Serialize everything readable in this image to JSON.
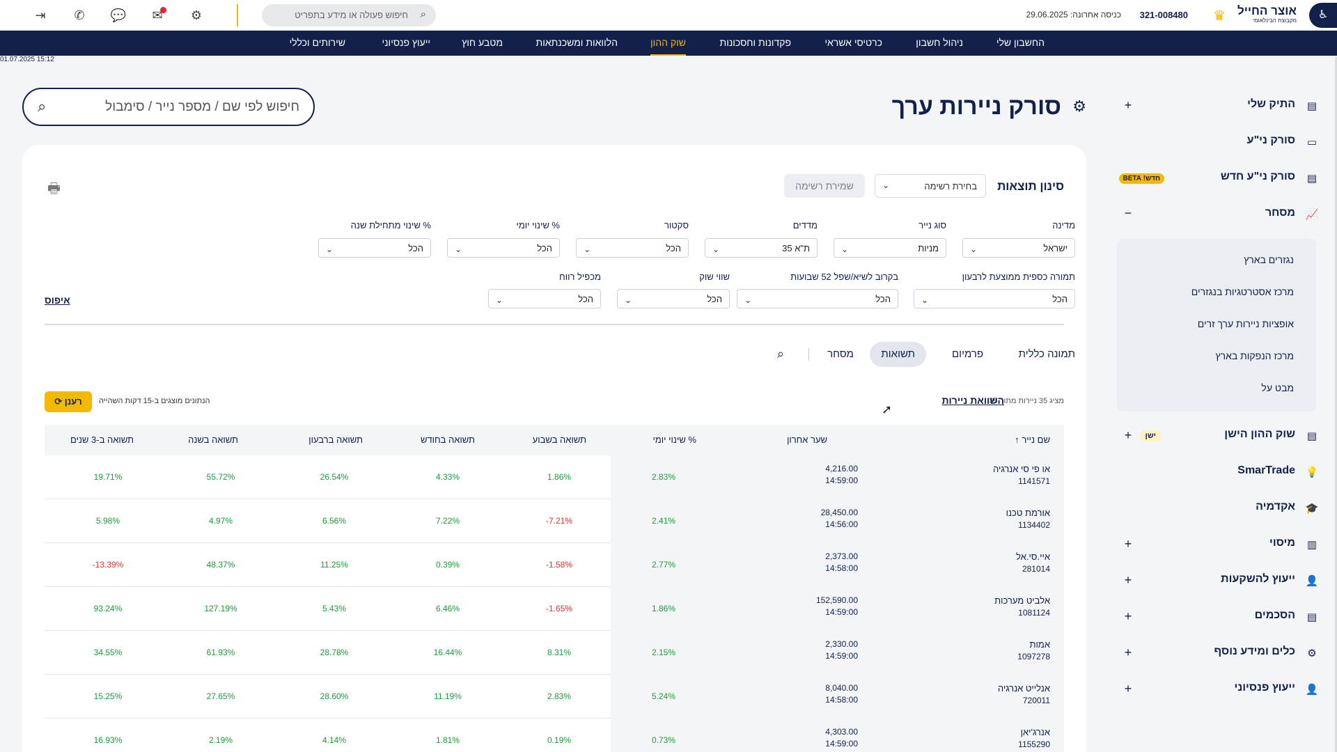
{
  "header": {
    "logo_main": "אוצר החייל",
    "logo_sub": "מקבוצת הבינלאומי",
    "account": "321-008480",
    "last_login": "כניסה אחרונה: 29.06.2025",
    "search_placeholder": "חיפוש פעולה או מידע בתפריט"
  },
  "nav": [
    "החשבון שלי",
    "ניהול חשבון",
    "כרטיסי אשראי",
    "פקדונות וחסכונות",
    "שוק ההון",
    "הלוואות ומשכנתאות",
    "מטבע חוץ",
    "ייעוץ פנסיוני",
    "שירותים וכללי"
  ],
  "nav_active": "שוק ההון",
  "datetime": "01.07.2025 15:12",
  "sidebar": {
    "items": [
      "התיק שלי",
      "סורק ני\"ע",
      "סורק ני\"ע חדש",
      "מסחר",
      "שוק ההון הישן",
      "SmarTrade",
      "אקדמיה",
      "מיסוי",
      "ייעוץ להשקעות",
      "הסכמים",
      "כלים ומידע נוסף",
      "ייעוץ פנסיוני"
    ],
    "badge_new": "חדש! BETA",
    "badge_old": "ישן",
    "submenu": [
      "נגזרים בארץ",
      "מרכז אסטרטגיות בנגזרים",
      "אופציות ניירות ערך זרים",
      "מרכז הנפקות בארץ",
      "מבט על"
    ]
  },
  "page": {
    "title": "סורק ניירות ערך",
    "search_placeholder": "חיפוש לפי שם / מספר נייר / סימבול"
  },
  "filters": {
    "title": "סינון תוצאות",
    "list_select": "בחירת רשימה",
    "save_list": "שמירת רשימה",
    "row1": [
      {
        "label": "מדינה",
        "value": "ישראל"
      },
      {
        "label": "סוג נייר",
        "value": "מניות"
      },
      {
        "label": "מדדים",
        "value": "ת\"א 35"
      },
      {
        "label": "סקטור",
        "value": "הכל"
      },
      {
        "label": "% שינוי יומי",
        "value": "הכל"
      },
      {
        "label": "% שינוי מתחילת שנה",
        "value": "הכל"
      }
    ],
    "row2": [
      {
        "label": "תמורה כספית ממוצעת לרבעון",
        "value": "הכל"
      },
      {
        "label": "בקרוב לשיא/שפל 52 שבועות",
        "value": "הכל"
      },
      {
        "label": "שווי שוק",
        "value": "הכל"
      },
      {
        "label": "מכפיל רווח",
        "value": "הכל"
      }
    ],
    "reset": "איפוס"
  },
  "tabs": [
    "תמונה כללית",
    "פרמיום",
    "תשואות",
    "מסחר"
  ],
  "tab_active": "תשואות",
  "results": {
    "count": "מציג 35 ניירות מתוך 35",
    "compare": "השוואת ניירות",
    "delay": "הנתונים מוצגים ב-15 דקות השהייה",
    "refresh": "רענן"
  },
  "table": {
    "headers": [
      "שם נייר",
      "שער אחרון",
      "% שינוי יומי",
      "תשואה בשבוע",
      "תשואה בחודש",
      "תשואה ברבעון",
      "תשואה בשנה",
      "תשואה ב-3 שנים"
    ],
    "rows": [
      {
        "name": "או פי סי אנרגיה",
        "num": "1141571",
        "price": "4,216.00",
        "time": "14:59:00",
        "vals": [
          "2.83%",
          "1.86%",
          "4.33%",
          "26.54%",
          "55.72%",
          "19.71%"
        ]
      },
      {
        "name": "אורמת טכנו",
        "num": "1134402",
        "price": "28,450.00",
        "time": "14:56:00",
        "vals": [
          "2.41%",
          "-7.21%",
          "7.22%",
          "6.56%",
          "4.97%",
          "5.98%"
        ]
      },
      {
        "name": "איי.סי.אל",
        "num": "281014",
        "price": "2,373.00",
        "time": "14:58:00",
        "vals": [
          "2.77%",
          "-1.58%",
          "0.39%",
          "11.25%",
          "48.37%",
          "-13.39%"
        ]
      },
      {
        "name": "אלביט מערכות",
        "num": "1081124",
        "price": "152,590.00",
        "time": "14:59:00",
        "vals": [
          "1.86%",
          "-1.65%",
          "6.46%",
          "5.43%",
          "127.19%",
          "93.24%"
        ]
      },
      {
        "name": "אמות",
        "num": "1097278",
        "price": "2,330.00",
        "time": "14:59:00",
        "vals": [
          "2.15%",
          "8.31%",
          "16.44%",
          "28.78%",
          "61.93%",
          "34.55%"
        ]
      },
      {
        "name": "אנלייט אנרגיה",
        "num": "720011",
        "price": "8,040.00",
        "time": "14:58:00",
        "vals": [
          "5.24%",
          "2.83%",
          "11.19%",
          "28.60%",
          "27.65%",
          "15.25%"
        ]
      },
      {
        "name": "אנרג'יאן",
        "num": "1155290",
        "price": "4,303.00",
        "time": "14:59:00",
        "vals": [
          "0.73%",
          "0.19%",
          "1.81%",
          "4.14%",
          "2.19%",
          "16.93%"
        ]
      }
    ]
  },
  "colors": {
    "navy": "#12204a",
    "accent": "#f5b800",
    "positive": "#1e9a3a",
    "negative": "#e02f2f"
  }
}
